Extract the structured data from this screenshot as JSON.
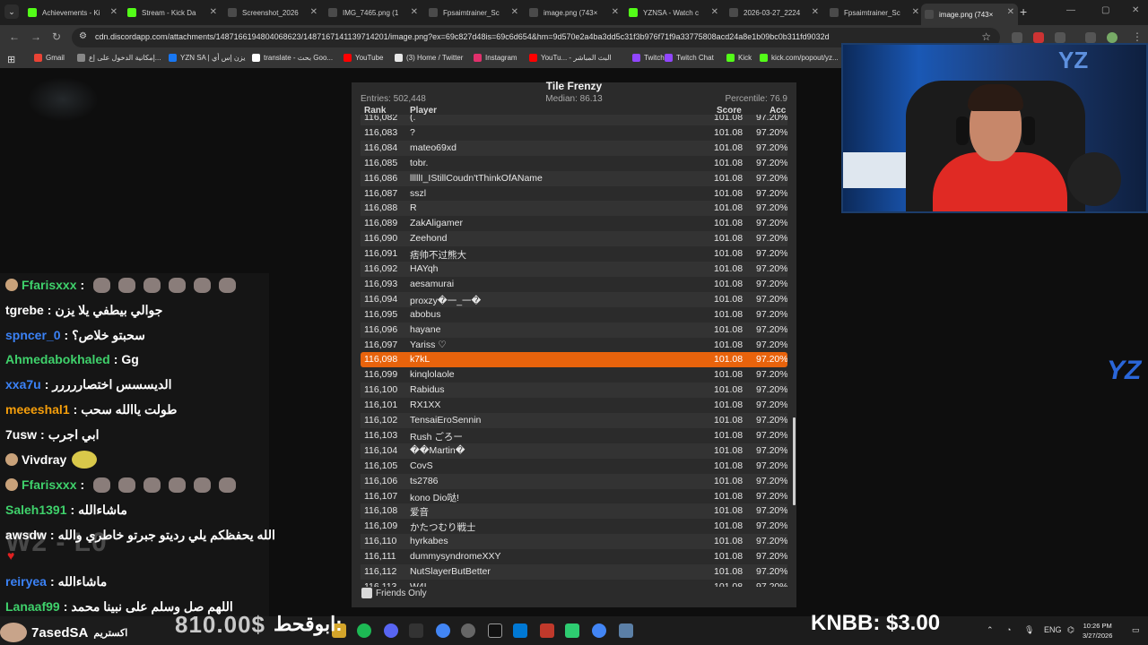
{
  "browser": {
    "tabs": [
      {
        "label": "Achievements - Ki",
        "color": "#53fc18"
      },
      {
        "label": "Stream - Kick Da",
        "color": "#53fc18"
      },
      {
        "label": "Screenshot_2026",
        "color": "#4a4a4a"
      },
      {
        "label": "IMG_7465.png (1",
        "color": "#4a4a4a"
      },
      {
        "label": "Fpsaimtrainer_Sc",
        "color": "#4a4a4a"
      },
      {
        "label": "image.png (743×",
        "color": "#4a4a4a"
      },
      {
        "label": "YZNSA - Watch c",
        "color": "#53fc18"
      },
      {
        "label": "2026-03-27_2224",
        "color": "#4a4a4a"
      },
      {
        "label": "Fpsaimtrainer_Sc",
        "color": "#4a4a4a"
      },
      {
        "label": "image.png (743×",
        "color": "#4a4a4a",
        "active": true
      }
    ],
    "url": "cdn.discordapp.com/attachments/1487166194804068623/1487167141139714201/image.png?ex=69c827d48is=69c6d654&hm=9d570e2a4ba3dd5c31f3b976f71f9a33775808acd24a8e1b09bc0b311fd9032d",
    "bookmarks": [
      {
        "label": "Gmail",
        "color": "#ea4335"
      },
      {
        "label": "إمكانية الدخول على إع...",
        "color": "#888888"
      },
      {
        "label": "YZN SA | يزن إس أي",
        "color": "#1877f2"
      },
      {
        "label": "translate - بحث Goo...",
        "color": "#ffffff"
      },
      {
        "label": "YouTube",
        "color": "#ff0000"
      },
      {
        "label": "(3) Home / Twitter",
        "color": "#e7e7e7"
      },
      {
        "label": "Instagram",
        "color": "#e1306c"
      },
      {
        "label": "YouTu... - البث المباشر",
        "color": "#ff0000"
      },
      {
        "label": "Twitch",
        "color": "#9146ff"
      },
      {
        "label": "Twitch Chat",
        "color": "#9146ff"
      },
      {
        "label": "Kick",
        "color": "#53fc18"
      },
      {
        "label": "kick.com/popout/yz...",
        "color": "#53fc18"
      }
    ]
  },
  "leaderboard": {
    "title": "Tile Frenzy",
    "entries": "Entries: 502,448",
    "median": "Median: 86.13",
    "percentile": "Percentile: 76.9",
    "headers": {
      "rank": "Rank",
      "player": "Player",
      "score": "Score",
      "acc": "Acc"
    },
    "friends_only": "Friends Only",
    "rows": [
      {
        "rank": "116,082",
        "player": "(.",
        "score": "101.08",
        "acc": "97.20%"
      },
      {
        "rank": "116,083",
        "player": "?",
        "score": "101.08",
        "acc": "97.20%"
      },
      {
        "rank": "116,084",
        "player": "mateo69xd",
        "score": "101.08",
        "acc": "97.20%"
      },
      {
        "rank": "116,085",
        "player": "tobr.",
        "score": "101.08",
        "acc": "97.20%"
      },
      {
        "rank": "116,086",
        "player": "lllllI_IStillCoudn'tThinkOfAName",
        "score": "101.08",
        "acc": "97.20%"
      },
      {
        "rank": "116,087",
        "player": "sszl",
        "score": "101.08",
        "acc": "97.20%"
      },
      {
        "rank": "116,088",
        "player": "R",
        "score": "101.08",
        "acc": "97.20%"
      },
      {
        "rank": "116,089",
        "player": "ZakAligamer",
        "score": "101.08",
        "acc": "97.20%"
      },
      {
        "rank": "116,090",
        "player": "Zeehond",
        "score": "101.08",
        "acc": "97.20%"
      },
      {
        "rank": "116,091",
        "player": "痞帅不过熊大",
        "score": "101.08",
        "acc": "97.20%"
      },
      {
        "rank": "116,092",
        "player": "HAYqh",
        "score": "101.08",
        "acc": "97.20%"
      },
      {
        "rank": "116,093",
        "player": "aesamurai",
        "score": "101.08",
        "acc": "97.20%"
      },
      {
        "rank": "116,094",
        "player": "proxzy�一_一�",
        "score": "101.08",
        "acc": "97.20%"
      },
      {
        "rank": "116,095",
        "player": "abobus",
        "score": "101.08",
        "acc": "97.20%"
      },
      {
        "rank": "116,096",
        "player": "hayane",
        "score": "101.08",
        "acc": "97.20%"
      },
      {
        "rank": "116,097",
        "player": "Yariss ♡",
        "score": "101.08",
        "acc": "97.20%"
      },
      {
        "rank": "116,098",
        "player": "k7kL",
        "score": "101.08",
        "acc": "97.20%",
        "highlight": true
      },
      {
        "rank": "116,099",
        "player": "kinqlolaole",
        "score": "101.08",
        "acc": "97.20%"
      },
      {
        "rank": "116,100",
        "player": "Rabidus",
        "score": "101.08",
        "acc": "97.20%"
      },
      {
        "rank": "116,101",
        "player": "RX1XX",
        "score": "101.08",
        "acc": "97.20%"
      },
      {
        "rank": "116,102",
        "player": "TensaiEroSennin",
        "score": "101.08",
        "acc": "97.20%"
      },
      {
        "rank": "116,103",
        "player": "Rush ごろー",
        "score": "101.08",
        "acc": "97.20%"
      },
      {
        "rank": "116,104",
        "player": "��Martin�",
        "score": "101.08",
        "acc": "97.20%"
      },
      {
        "rank": "116,105",
        "player": "CovS",
        "score": "101.08",
        "acc": "97.20%"
      },
      {
        "rank": "116,106",
        "player": "ts2786",
        "score": "101.08",
        "acc": "97.20%"
      },
      {
        "rank": "116,107",
        "player": "kono Dio哒!",
        "score": "101.08",
        "acc": "97.20%"
      },
      {
        "rank": "116,108",
        "player": "爱音",
        "score": "101.08",
        "acc": "97.20%"
      },
      {
        "rank": "116,109",
        "player": "かたつむり戦士",
        "score": "101.08",
        "acc": "97.20%"
      },
      {
        "rank": "116,110",
        "player": "hyrkabes",
        "score": "101.08",
        "acc": "97.20%"
      },
      {
        "rank": "116,111",
        "player": "dummysyndromeXXY",
        "score": "101.08",
        "acc": "97.20%"
      },
      {
        "rank": "116,112",
        "player": "NutSlayerButBetter",
        "score": "101.08",
        "acc": "97.20%"
      },
      {
        "rank": "116,113",
        "player": "W4L",
        "score": "101.08",
        "acc": "97.20%"
      }
    ]
  },
  "chat": {
    "messages": [
      {
        "user": "Ffarisxxx",
        "color": "#3fd16b",
        "text": "",
        "emotes": 6,
        "avatar": true
      },
      {
        "user": "tgrebe",
        "color": "#ffffff",
        "text": "جوالي بيطفي يلا يزن"
      },
      {
        "user": "spncer_0",
        "color": "#3b82f6",
        "text": "سحبتو خلاص؟"
      },
      {
        "user": "Ahmedabokhaled",
        "color": "#3fd16b",
        "text": "Gg"
      },
      {
        "user": "xxa7u",
        "color": "#3b82f6",
        "text": "الديسسس اختصاررررر"
      },
      {
        "user": "meeeshal1",
        "color": "#f59e0b",
        "text": "طولت ياالله سحب"
      },
      {
        "user": "7usw",
        "color": "#ffffff",
        "text": "ابي اجرب"
      },
      {
        "user": "Vivdray",
        "color": "#ffffff",
        "text": "",
        "avatar": true,
        "sticker": true
      },
      {
        "user": "Ffarisxxx",
        "color": "#3fd16b",
        "text": "",
        "emotes": 6,
        "avatar": true
      },
      {
        "user": "Saleh1391",
        "color": "#3fd16b",
        "text": "ماشاءالله"
      },
      {
        "user": "awsdw",
        "color": "#ffffff",
        "text": "الله يحفظكم يلي رديتو جبرتو خاطري والله"
      },
      {
        "user": "reiryea",
        "color": "#3b82f6",
        "text": "ماشاءالله"
      },
      {
        "user": "Lanaaf99",
        "color": "#3fd16b",
        "text": "اللهم صل وسلم على نبينا محمد"
      }
    ],
    "watermark": "W2 - L0"
  },
  "overlay": {
    "price": "810.00$",
    "arabic_label": "ابوقحط:",
    "knbb": "KNBB: $3.00",
    "sub_user": "7asedSA",
    "sub_label": "اكستريم"
  },
  "taskbar": {
    "lang": "ENG",
    "time": "10:26 PM",
    "date": "3/27/2026"
  }
}
